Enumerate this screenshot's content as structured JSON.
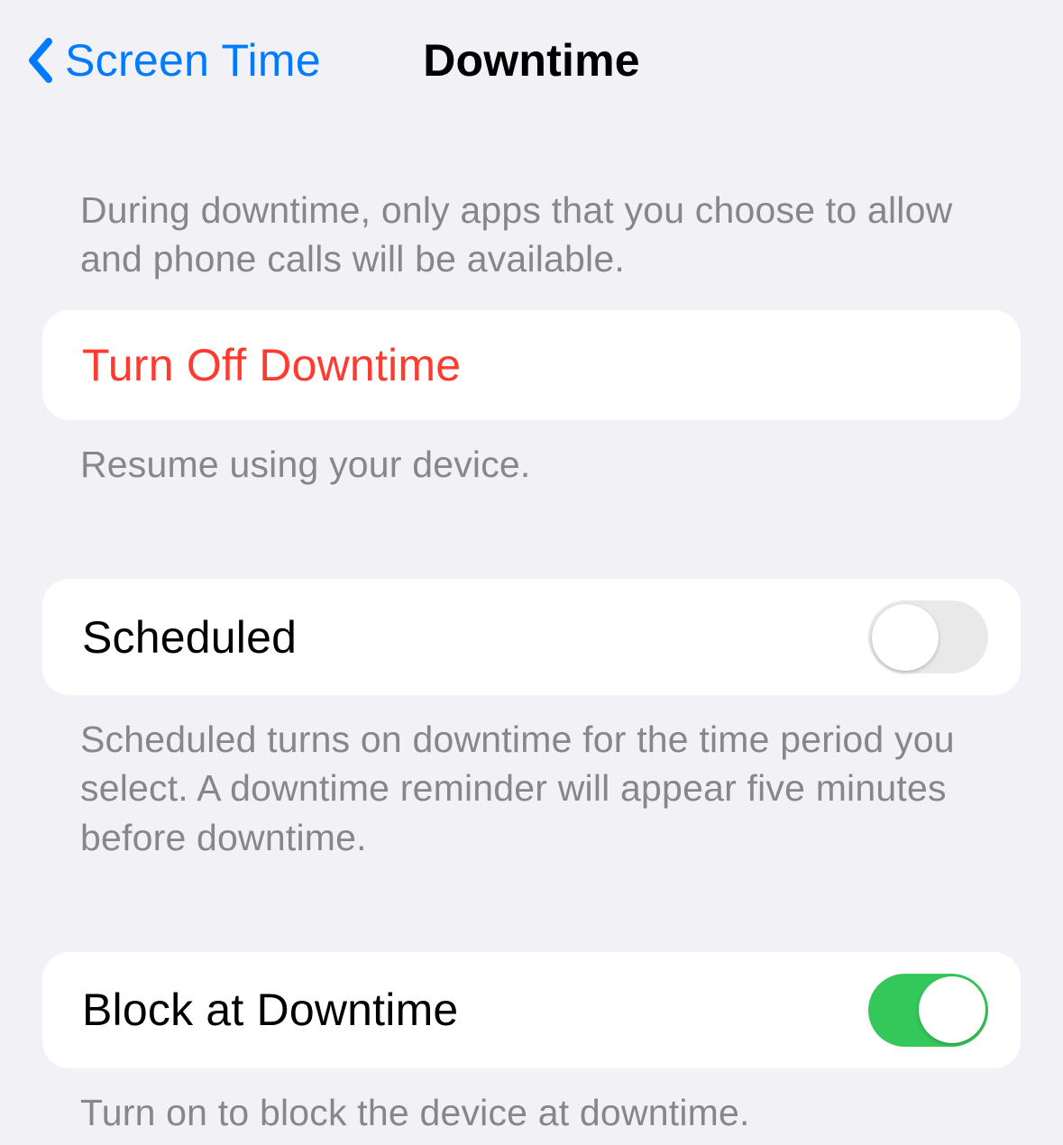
{
  "header": {
    "back_label": "Screen Time",
    "title": "Downtime"
  },
  "intro": "During downtime, only apps that you choose to allow and phone calls will be available.",
  "turn_off": {
    "label": "Turn Off Downtime",
    "footer": "Resume using your device."
  },
  "scheduled": {
    "label": "Scheduled",
    "enabled": false,
    "footer": "Scheduled turns on downtime for the time period you select. A downtime reminder will appear five minutes before downtime."
  },
  "block": {
    "label": "Block at Downtime",
    "enabled": true,
    "footer": "Turn on to block the device at downtime."
  }
}
